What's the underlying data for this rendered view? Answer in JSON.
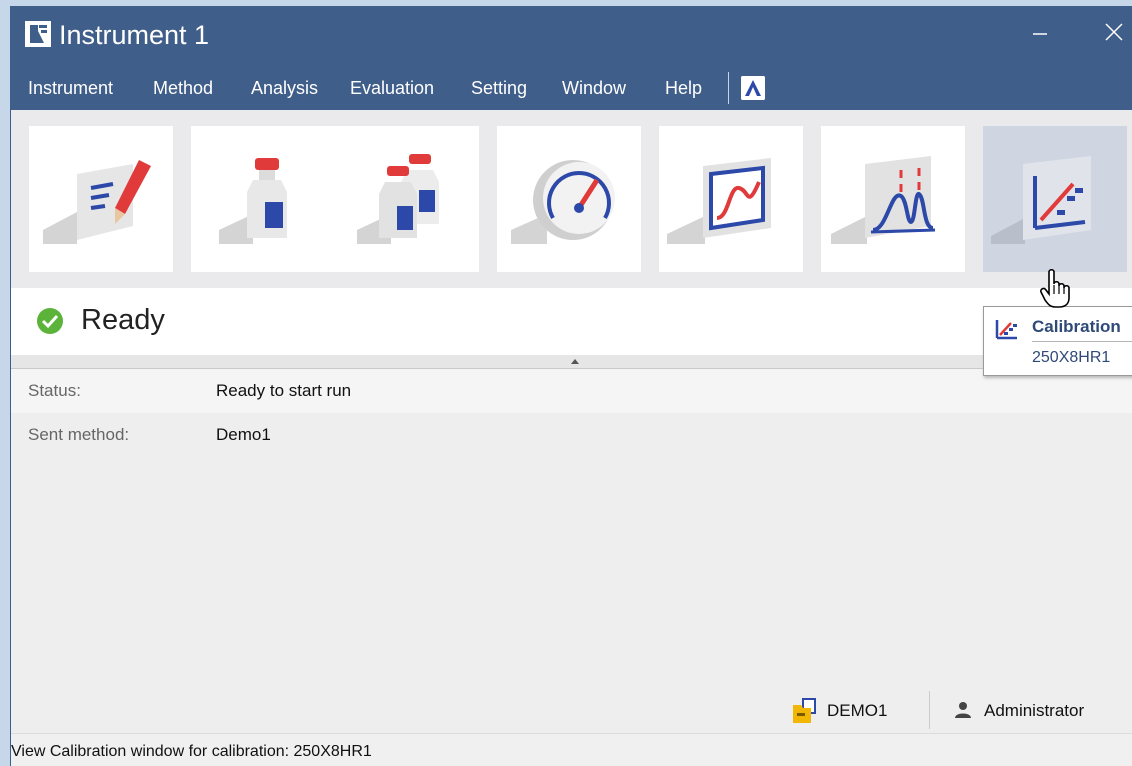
{
  "window": {
    "title": "Instrument 1"
  },
  "menu": {
    "items": [
      {
        "label": "Instrument"
      },
      {
        "label": "Method"
      },
      {
        "label": "Analysis"
      },
      {
        "label": "Evaluation"
      },
      {
        "label": "Setting"
      },
      {
        "label": "Window"
      },
      {
        "label": "Help"
      }
    ]
  },
  "toolbar": {
    "tiles": [
      {
        "icon": "edit-method-icon"
      },
      {
        "icon": "single-sample-icon"
      },
      {
        "icon": "batch-samples-icon"
      },
      {
        "icon": "gauge-icon"
      },
      {
        "icon": "monitor-chart-icon"
      },
      {
        "icon": "chromatogram-icon"
      },
      {
        "icon": "calibration-icon"
      }
    ],
    "active_tile": "calibration"
  },
  "status_panel": {
    "state": "Ready"
  },
  "info": {
    "rows": [
      {
        "label": "Status:",
        "value": "Ready to start run"
      },
      {
        "label": "Sent method:",
        "value": "Demo1"
      }
    ]
  },
  "footer": {
    "method": "DEMO1",
    "user": "Administrator"
  },
  "statusline": {
    "text": "View Calibration window for calibration: 250X8HR1"
  },
  "tooltip": {
    "title": "Calibration",
    "subtitle": "250X8HR1"
  },
  "colors": {
    "titlebar": "#405e8a",
    "accent_blue": "#2c48a8",
    "accent_red": "#e03a3a",
    "ready_green": "#5cb33a",
    "folder_yellow": "#f2b705"
  }
}
